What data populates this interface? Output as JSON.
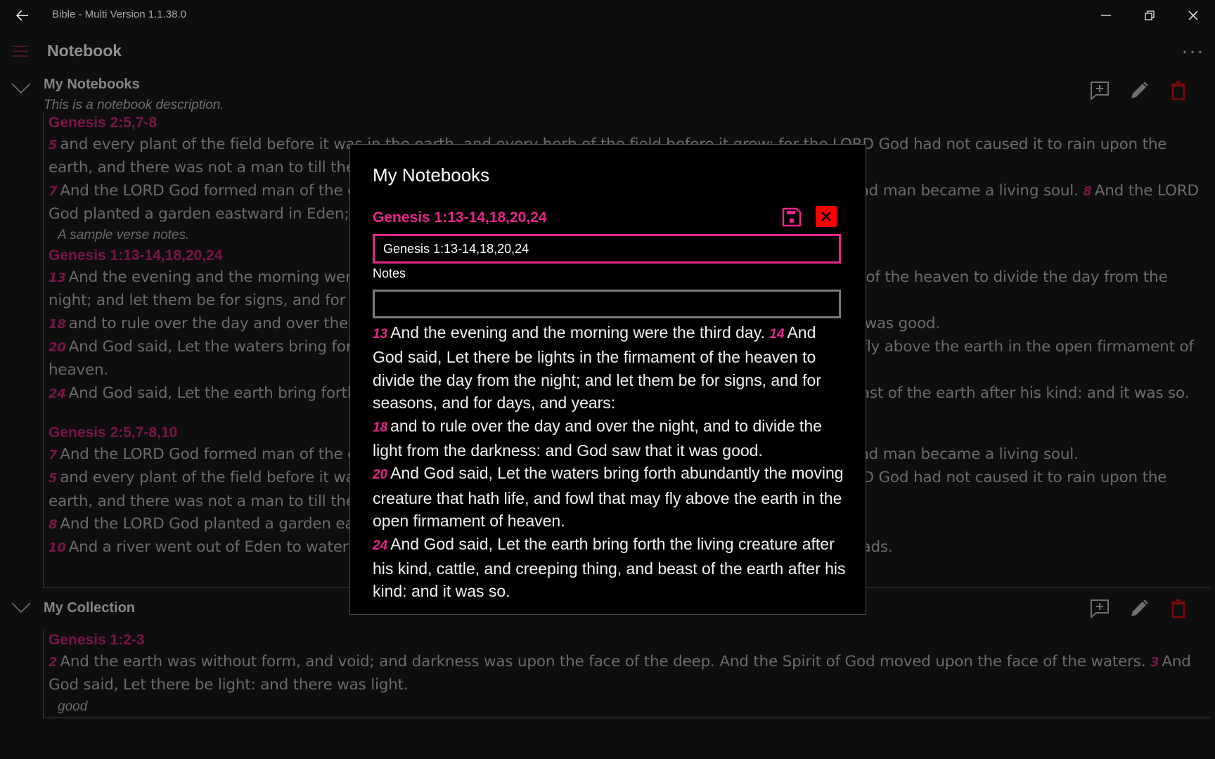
{
  "app": {
    "title": "Bible - Multi Version 1.1.38.0",
    "page_title": "Notebook",
    "accent_color": "#e8258c",
    "dim_accent_color": "#7a1548",
    "danger_color": "#ff0000"
  },
  "window_controls": {
    "back": "back-arrow-icon",
    "minimize": "minimize-icon",
    "restore": "restore-icon",
    "close": "close-icon",
    "more": "more-icon"
  },
  "groups": [
    {
      "title": "My Notebooks",
      "description": "This is a notebook description.",
      "actions": [
        "add-note-icon",
        "edit-pencil-icon",
        "delete-trash-icon"
      ],
      "entries": [
        {
          "reference": "Genesis 2:5,7-8",
          "lines": [
            [
              {
                "num": "5",
                "text": "and every plant of the field before it was in the earth, and every herb of the field before it grew: for the LORD God had not caused it to rain upon the earth, and there was not a man to till the ground."
              }
            ],
            [
              {
                "num": "7",
                "text": "And the LORD God formed man of the dust of the ground, and breathed into his nostrils the breath of life; and man became a living soul."
              },
              {
                "num": "8",
                "text": "And the LORD God planted a garden eastward in Eden; and there he put the man whom he had formed."
              }
            ]
          ],
          "note": "A sample verse notes."
        },
        {
          "reference": "Genesis 1:13-14,18,20,24",
          "lines": [
            [
              {
                "num": "13",
                "text": "And the evening and the morning were the third day."
              },
              {
                "num": "14",
                "text": "And God said, Let there be lights in the firmament of the heaven to divide the day from the night; and let them be for signs, and for seasons, and for days, and years:"
              }
            ],
            [
              {
                "num": "18",
                "text": "and to rule over the day and over the night, and to divide the light from the darkness: and God saw that it was good."
              }
            ],
            [
              {
                "num": "20",
                "text": "And God said, Let the waters bring forth abundantly the moving creature that hath life, and fowl that may fly above the earth in the open firmament of heaven."
              }
            ],
            [
              {
                "num": "24",
                "text": "And God said, Let the earth bring forth the living creature after his kind, cattle, and creeping thing, and beast of the earth after his kind: and it was so."
              }
            ]
          ],
          "note": ""
        },
        {
          "reference": "Genesis 2:5,7-8,10",
          "lines": [
            [
              {
                "num": "7",
                "text": "And the LORD God formed man of the dust of the ground, and breathed into his nostrils the breath of life; and man became a living soul."
              }
            ],
            [
              {
                "num": "5",
                "text": "and every plant of the field before it was in the earth, and every herb of the field before it grew: for the LORD God had not caused it to rain upon the earth, and there was not a man to till the ground."
              }
            ],
            [
              {
                "num": "8",
                "text": "And the LORD God planted a garden eastward in Eden; and there he put the man whom he had formed."
              }
            ],
            [
              {
                "num": "10",
                "text": "And a river went out of Eden to water the garden; and from thence it was parted, and became into four heads."
              }
            ]
          ],
          "note": ""
        }
      ]
    },
    {
      "title": "My Collection",
      "description": "",
      "actions": [
        "add-note-icon",
        "edit-pencil-icon",
        "delete-trash-icon"
      ],
      "entries": [
        {
          "reference": "Genesis 1:2-3",
          "lines": [
            [
              {
                "num": "2",
                "text": "And the earth was without form, and void; and darkness was upon the face of the deep. And the Spirit of God moved upon the face of the waters."
              },
              {
                "num": "3",
                "text": "And God said, Let there be light: and there was light."
              }
            ]
          ],
          "note": "good"
        }
      ]
    }
  ],
  "dialog": {
    "title": "My Notebooks",
    "reference": "Genesis 1:13-14,18,20,24",
    "save_icon": "save-floppy-icon",
    "close_icon": "close-x-icon",
    "reference_input_value": "Genesis 1:13-14,18,20,24",
    "notes_label": "Notes",
    "notes_value": "",
    "verses": [
      {
        "num": "13",
        "text": "And the evening and the morning were the third day."
      },
      {
        "num": "14",
        "text": "And God said, Let there be lights in the firmament of the heaven to divide the day from the night; and let them be for signs, and for seasons, and for days, and years:"
      },
      {
        "num": "18",
        "text": "and to rule over the day and over the night, and to divide the light from the darkness: and God saw that it was good."
      },
      {
        "num": "20",
        "text": "And God said, Let the waters bring forth abundantly the moving creature that hath life, and fowl that may fly above the earth in the open firmament of heaven."
      },
      {
        "num": "24",
        "text": "And God said, Let the earth bring forth the living creature after his kind, cattle, and creeping thing, and beast of the earth after his kind: and it was so."
      }
    ]
  }
}
